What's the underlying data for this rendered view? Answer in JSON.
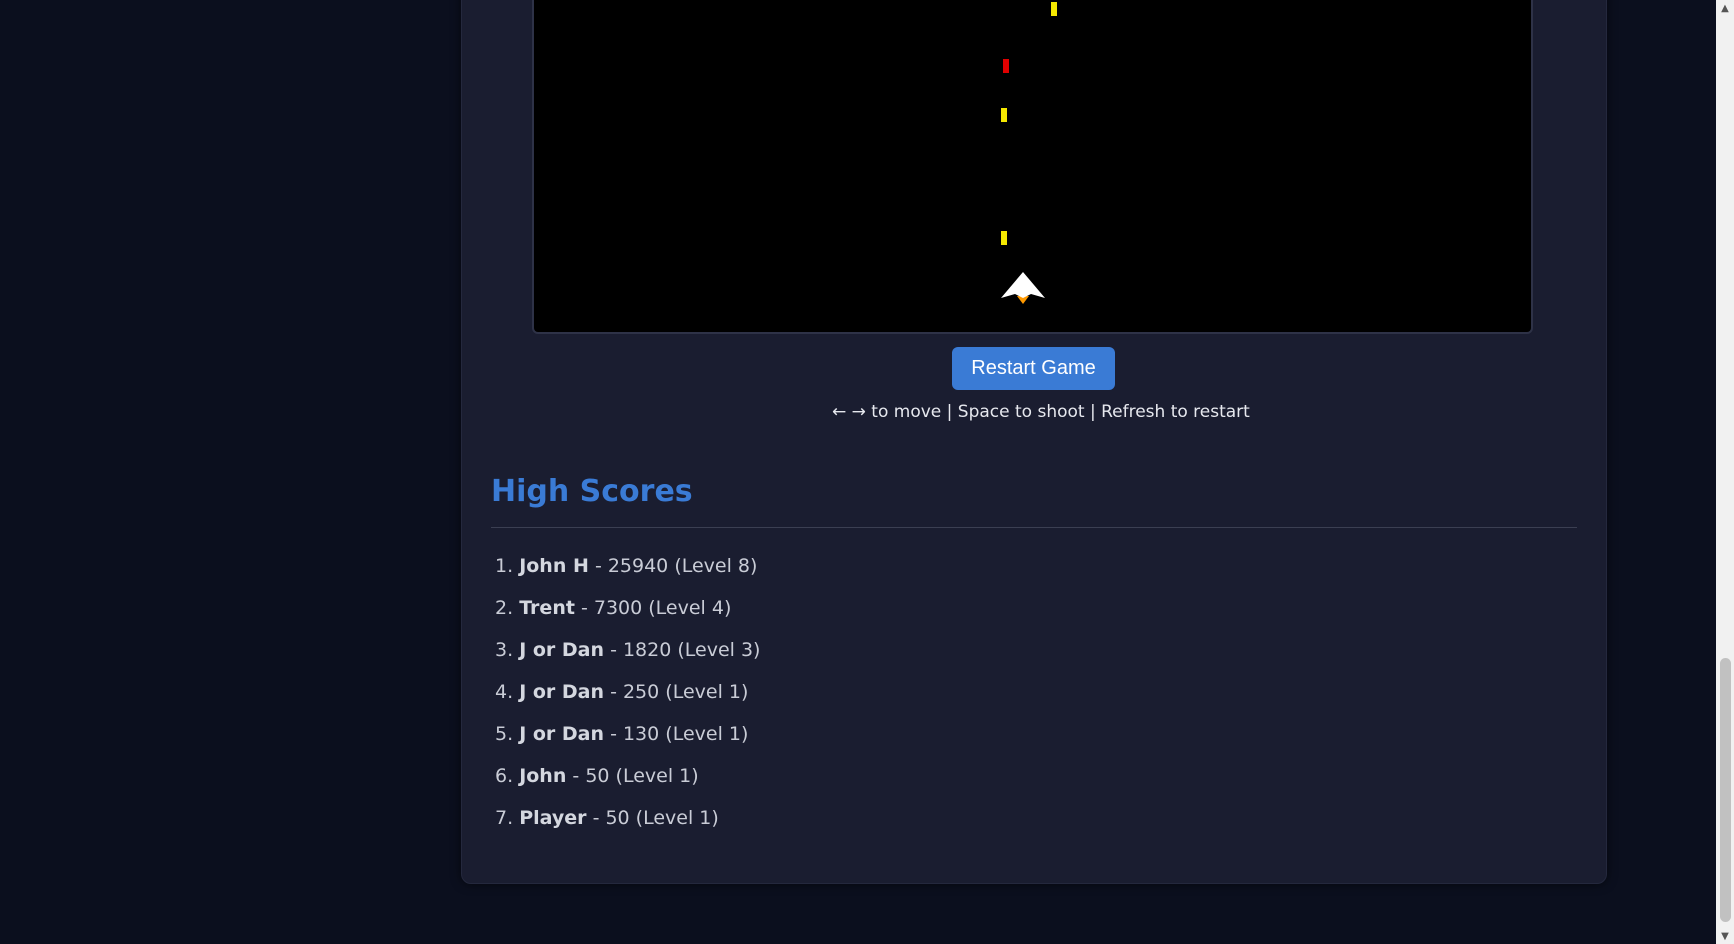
{
  "game": {
    "bullets": [
      {
        "color": "#f5e800"
      },
      {
        "color": "#e00000"
      },
      {
        "color": "#f5e800"
      },
      {
        "color": "#f5e800"
      }
    ],
    "ship_icon": "player-ship-icon",
    "ship_color": "#ffffff",
    "flame_color": "#ff9900"
  },
  "restart_label": "Restart Game",
  "controls_text": "← → to move | Space to shoot | Refresh to restart",
  "high_scores": {
    "title": "High Scores",
    "entries": [
      {
        "rank": "1.",
        "name": "John H",
        "detail": "- 25940 (Level 8)"
      },
      {
        "rank": "2.",
        "name": "Trent",
        "detail": "- 7300 (Level 4)"
      },
      {
        "rank": "3.",
        "name": "J or Dan",
        "detail": "- 1820 (Level 3)"
      },
      {
        "rank": "4.",
        "name": "J or Dan",
        "detail": "- 250 (Level 1)"
      },
      {
        "rank": "5.",
        "name": "J or Dan",
        "detail": "- 130 (Level 1)"
      },
      {
        "rank": "6.",
        "name": "John",
        "detail": "- 50 (Level 1)"
      },
      {
        "rank": "7.",
        "name": "Player",
        "detail": "- 50 (Level 1)"
      }
    ]
  },
  "colors": {
    "accent": "#3a7bd5",
    "background": "#0b0f1e",
    "panel": "#1a1d30"
  }
}
